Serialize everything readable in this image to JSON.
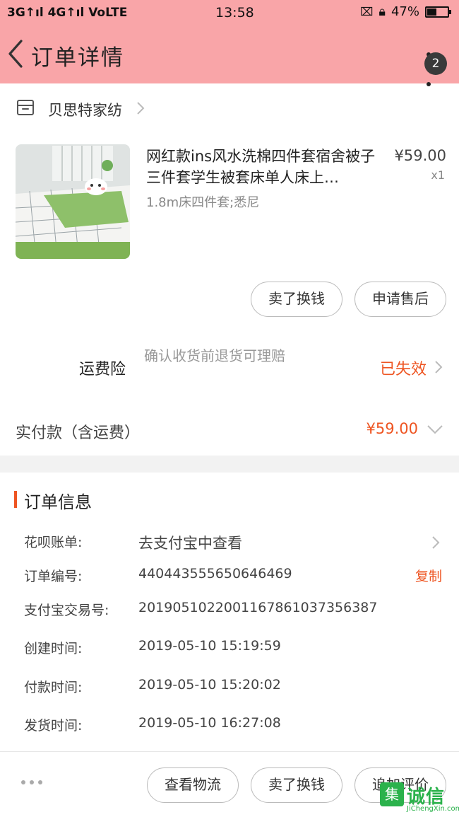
{
  "status_bar": {
    "signal": "3G↑ıl 4G↑ıl VoLTE",
    "time": "13:58",
    "battery_text": "47%",
    "battery_level": 0.47
  },
  "header": {
    "title": "订单详情",
    "badge_count": "2"
  },
  "shop": {
    "name": "贝思特家纺"
  },
  "product": {
    "title": "网红款ins风水洗棉四件套宿舍被子三件套学生被套床单人床上…",
    "spec": "1.8m床四件套;悉尼",
    "price": "¥59.00",
    "quantity": "x1"
  },
  "product_actions": {
    "resell": "卖了换钱",
    "after_sale": "申请售后"
  },
  "insurance": {
    "label": "运费险",
    "description": "确认收货前退货可理赔",
    "status": "已失效"
  },
  "payment": {
    "label": "实付款（含运费）",
    "amount": "¥59.00"
  },
  "order_info": {
    "title": "订单信息",
    "rows": [
      {
        "label": "花呗账单:",
        "value": "去支付宝中查看"
      },
      {
        "label": "订单编号:",
        "value": "440443555650646469",
        "action": "复制"
      },
      {
        "label": "支付宝交易号:",
        "value": "2019051022001167861037356387"
      },
      {
        "label": "创建时间:",
        "value": "2019-05-10 15:19:59"
      },
      {
        "label": "付款时间:",
        "value": "2019-05-10 15:20:02"
      },
      {
        "label": "发货时间:",
        "value": "2019-05-10 16:27:08"
      }
    ]
  },
  "bottom_bar": {
    "view_logistics": "查看物流",
    "resell": "卖了换钱",
    "add_review": "追加评价"
  },
  "watermark": {
    "text": "诚信",
    "url": "JiChengXin.com"
  },
  "colors": {
    "header_bg": "#f9a5a8",
    "accent": "#ee5522"
  }
}
